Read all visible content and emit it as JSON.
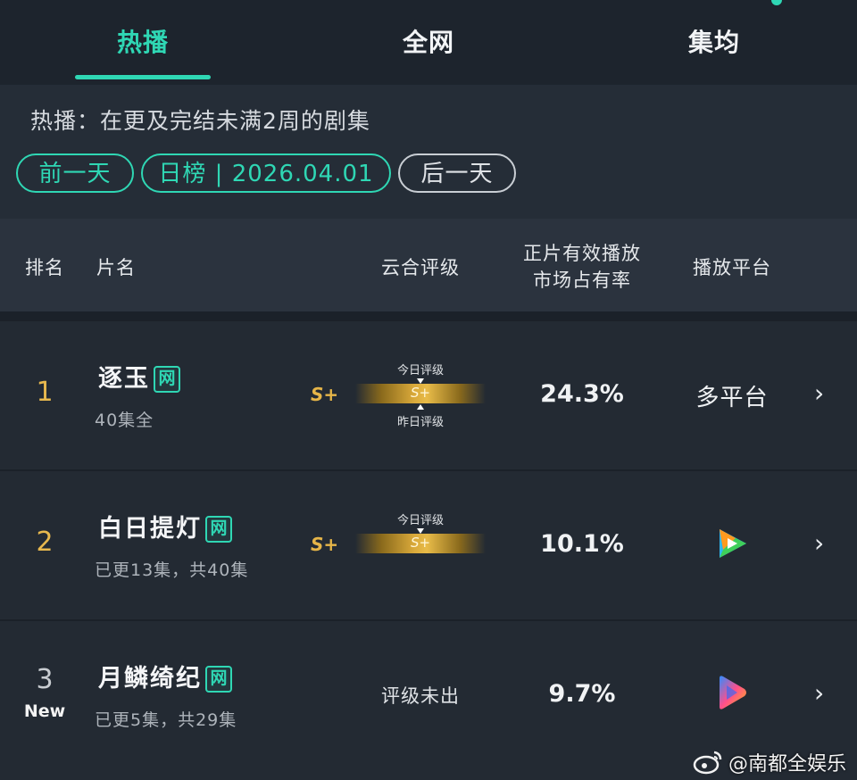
{
  "tabs": [
    {
      "label": "热播",
      "active": true
    },
    {
      "label": "全网",
      "active": false
    },
    {
      "label": "集均",
      "active": false
    }
  ],
  "description": "热播：在更及完结未满2周的剧集",
  "date_nav": {
    "prev": "前一天",
    "current": "日榜 | 2026.04.01",
    "next": "后一天"
  },
  "table_headers": {
    "rank": "排名",
    "title": "片名",
    "rating": "云合评级",
    "share_line1": "正片有效播放",
    "share_line2": "市场占有率",
    "platform": "播放平台"
  },
  "rows": [
    {
      "rank": "1",
      "title": "逐玉",
      "badge": "网",
      "episodes": "40集全",
      "grade": "S+",
      "bar_grade": "S+",
      "today_label": "今日评级",
      "yesterday_label": "昨日评级",
      "share": "24.3%",
      "platform": "多平台"
    },
    {
      "rank": "2",
      "title": "白日提灯",
      "badge": "网",
      "episodes": "已更13集，共40集",
      "grade": "S+",
      "bar_grade": "S+",
      "today_label": "今日评级",
      "share": "10.1%",
      "platform_icon": "tencent-video-icon"
    },
    {
      "rank": "3",
      "rank_tag": "New",
      "title": "月鳞绮纪",
      "badge": "网",
      "episodes": "已更5集，共29集",
      "rating_status": "评级未出",
      "share": "9.7%",
      "platform_icon": "youku-icon"
    }
  ],
  "watermark": "@南都全娱乐",
  "colors": {
    "accent": "#2fd7b4",
    "gold": "#e6b548",
    "background": "#1b2129"
  }
}
